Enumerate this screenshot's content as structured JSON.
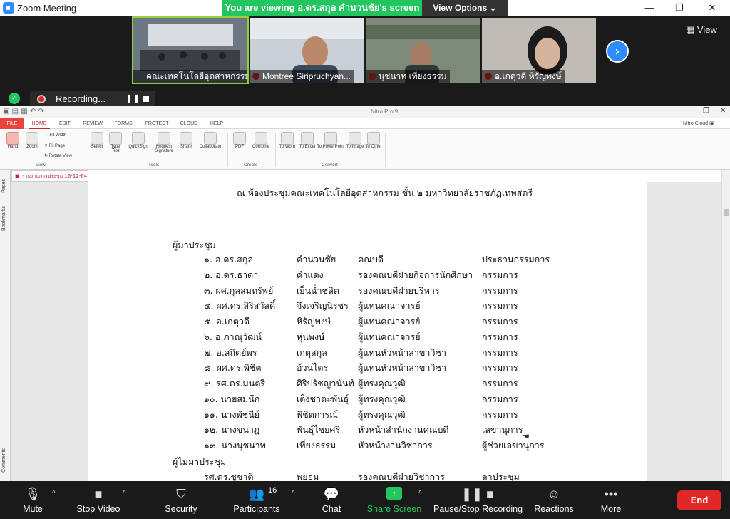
{
  "zoom": {
    "window_title": "Zoom Meeting",
    "banner": "You are viewing อ.ดร.สกุล คำนวนชัย's screen",
    "view_options": "View Options",
    "view_button": "View",
    "recording_label": "Recording...",
    "participants": [
      {
        "name": "คณะเทคโนโลยีอุตสาหกรรม !",
        "active": true
      },
      {
        "name": "Montree Siripruchyan...",
        "active": false
      },
      {
        "name": "นุชนาท เที่ยงธรรม",
        "active": false
      },
      {
        "name": "อ.เกตุวดี หิรัญพงษ์",
        "active": false
      }
    ],
    "controls": {
      "mute": "Mute",
      "stop_video": "Stop Video",
      "security": "Security",
      "participants": "Participants",
      "participants_count": "16",
      "chat": "Chat",
      "share_screen": "Share Screen",
      "record": "Pause/Stop Recording",
      "reactions": "Reactions",
      "more": "More",
      "end": "End"
    }
  },
  "nitro": {
    "app_title": "Nitro Pro 9",
    "tabs": [
      "FILE",
      "HOME",
      "EDIT",
      "REVIEW",
      "FORMS",
      "PROTECT",
      "CLOUD",
      "HELP"
    ],
    "selected_tab": "HOME",
    "cloud_label": "Nitro Cloud",
    "ribbon": {
      "hand": "Hand",
      "zoom": "Zoom",
      "fit_width": "Fit Width",
      "fit_page": "Fit Page",
      "rotate_view": "Rotate View",
      "select": "Select",
      "type_text": "Type Text",
      "quicksign": "QuickSign",
      "request_signature": "Request Signature",
      "share": "Share",
      "collaborate": "Collaborate",
      "pdf": "PDF",
      "combine": "Combine",
      "to_word": "To Word",
      "to_excel": "To Excel",
      "to_powerpoint": "To PowerPoint",
      "to_image": "To Image",
      "to_other": "To Other",
      "group_view": "View",
      "group_tools": "Tools",
      "group_create": "Create",
      "group_convert": "Convert"
    },
    "side_pages": "Pages",
    "side_bookmarks": "Bookmarks",
    "side_comments": "Comments",
    "doc_tab": "รายงานการประชุม 16-12-64"
  },
  "document": {
    "venue": "ณ ห้องประชุมคณะเทคโนโลยีอุตสาหกรรม ชั้น ๒ มหาวิทยาลัยราชภัฏเทพสตรี",
    "present_heading": "ผู้มาประชุม",
    "present": [
      {
        "no": "๑. อ.ดร.สกุล",
        "surname": "คำนวนชัย",
        "position": "คณบดี",
        "role": "ประธานกรรมการ"
      },
      {
        "no": "๒. อ.ดร.ธาดา",
        "surname": "คำแดง",
        "position": "รองคณบดีฝ่ายกิจการนักศึกษา",
        "role": "กรรมการ"
      },
      {
        "no": "๓. ผศ.กุลสมทรัพย์",
        "surname": "เย็นฉ่ำชลิต",
        "position": "รองคณบดีฝ่ายบริหาร",
        "role": "กรรมการ"
      },
      {
        "no": "๔. ผศ.ดร.สิริสวัสดิ์",
        "surname": "จึงเจริญนิรชร",
        "position": "ผู้แทนคณาจารย์",
        "role": "กรรมการ"
      },
      {
        "no": "๕. อ.เกตุวดี",
        "surname": "หิรัญพงษ์",
        "position": "ผู้แทนคณาจารย์",
        "role": "กรรมการ"
      },
      {
        "no": "๖. อ.ภาณุวัฒน์",
        "surname": "หุ่นพงษ์",
        "position": "ผู้แทนคณาจารย์",
        "role": "กรรมการ"
      },
      {
        "no": "๗. อ.สถิตย์พร",
        "surname": "เกตุสกุล",
        "position": "ผู้แทนหัวหน้าสาขาวิชา",
        "role": "กรรมการ"
      },
      {
        "no": "๘. ผศ.ดร.พิชิต",
        "surname": "อ้วนไตร",
        "position": "ผู้แทนหัวหน้าสาขาวิชา",
        "role": "กรรมการ"
      },
      {
        "no": "๙. รศ.ดร.มนตรี",
        "surname": "ศิริปรัชญานันท์",
        "position": "ผู้ทรงคุณวุฒิ",
        "role": "กรรมการ"
      },
      {
        "no": "๑๐. นายสมนึก",
        "surname": "เต็งชาตะพันธุ์",
        "position": "ผู้ทรงคุณวุฒิ",
        "role": "กรรมการ"
      },
      {
        "no": "๑๑. นางพัชนีย์",
        "surname": "พิชิตการณ์",
        "position": "ผู้ทรงคุณวุฒิ",
        "role": "กรรมการ"
      },
      {
        "no": "๑๒. นางขนาฎ",
        "surname": "พันธุ์ไชยศรี",
        "position": "หัวหน้าสำนักงานคณบดี",
        "role": "เลขานุการ"
      },
      {
        "no": "๑๓. นางนุชนาท",
        "surname": "เที่ยงธรรม",
        "position": "หัวหน้างานวิชาการ",
        "role": "ผู้ช่วยเลขานุการ"
      }
    ],
    "absent_heading": "ผู้ไม่มาประชุม",
    "absent": [
      {
        "no": "รศ.ดร.ชูชาติ",
        "surname": "พยอม",
        "position": "รองคณบดีฝ่ายวิชาการ",
        "role": "ลาประชุม"
      }
    ]
  }
}
